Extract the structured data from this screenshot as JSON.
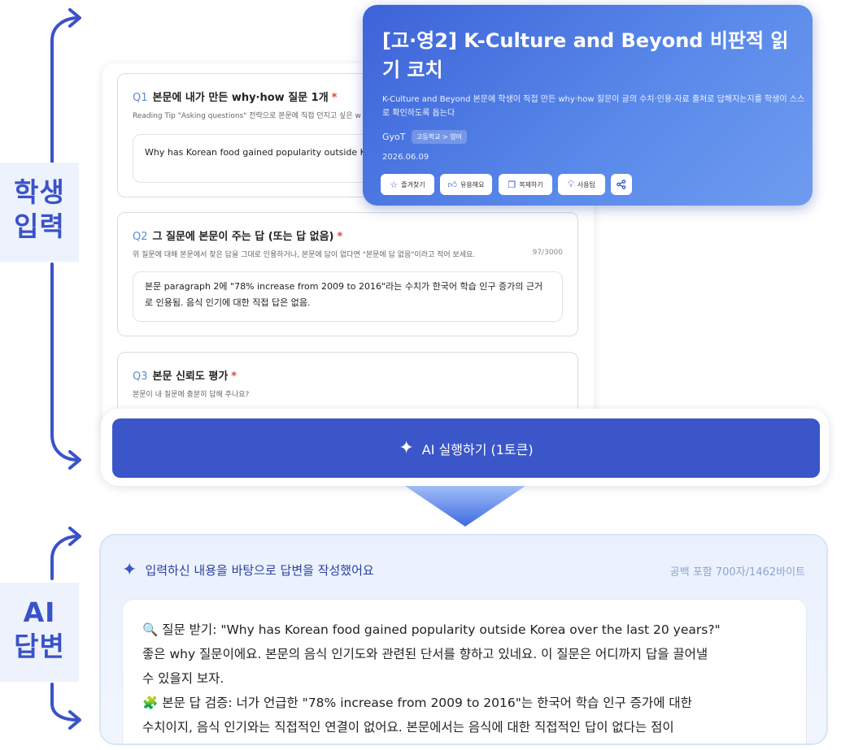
{
  "labels": {
    "student_input": [
      "학생",
      "입력"
    ],
    "ai_answer": [
      "AI",
      "답변"
    ]
  },
  "form": {
    "questions": [
      {
        "number": "Q1",
        "title": "본문에 내가 만든 why·how 질문 1개",
        "required_mark": "*",
        "description": "Reading Tip \"Asking questions\" 전략으로 본문에 직접 던지고 싶은 w",
        "answer": "Why has Korean food gained popularity outside Kore"
      },
      {
        "number": "Q2",
        "title": "그 질문에 본문이 주는 답 (또는 답 없음)",
        "required_mark": "*",
        "description": "위 질문에 대해 본문에서 찾은 답을 그대로 인용하거나, 본문에 답이 없다면 \"본문에 답 없음\"이라고 적어 보세요.",
        "counter": "97/3000",
        "answer": "본문 paragraph 2에 \"78% increase from 2009 to 2016\"라는 수치가 한국어 학습 인구 증가의 근거로 인용됨. 음식 인기에 대한 직접 답은 없음."
      },
      {
        "number": "Q3",
        "title": "본문 신뢰도 평가",
        "required_mark": "*",
        "description": "본문이 내 질문에 충분히 답해 주나요?"
      }
    ]
  },
  "info_card": {
    "title": "[고·영2] K-Culture and Beyond 비판적 읽기 코치",
    "description": "K-Culture and Beyond 본문에 학생이 직접 만든 why·how 질문이 글의 수치·인용·자료 출처로 답해지는지를 학생이 스스로 확인하도록 돕는다",
    "author": "GyoT",
    "tag": "고등학교 > 영어",
    "date": "2026.06.09",
    "buttons": {
      "favorite": "즐겨찾기",
      "helpful": "유용해요",
      "duplicate": "복제하기",
      "usage_tip": "사용팁"
    }
  },
  "run_button": {
    "label": "AI 실행하기 (1토큰)"
  },
  "ai_answer": {
    "header": "입력하신 내용을 바탕으로 답변을 작성했어요",
    "count": "공백 포함 700자/1462바이트",
    "lines": [
      "🔍 질문 받기: \"Why has Korean food gained popularity outside Korea over the last 20 years?\"",
      "좋은 why 질문이에요. 본문의 음식 인기도와 관련된 단서를 향하고 있네요. 이 질문은 어디까지 답을 끌어낼",
      "수 있을지 보자.",
      "🧩 본문 답 검증: 너가 언급한 \"78% increase from 2009 to 2016\"는 한국어 학습 인구 증가에 대한",
      "수치이지, 음식 인기와는 직접적인 연결이 없어요. 본문에서는 음식에 대한 직접적인 답이 없다는 점이"
    ]
  },
  "colors": {
    "brand_blue": "#3a56c8",
    "required_red": "#e0443a",
    "question_number": "#5b8bd6"
  }
}
